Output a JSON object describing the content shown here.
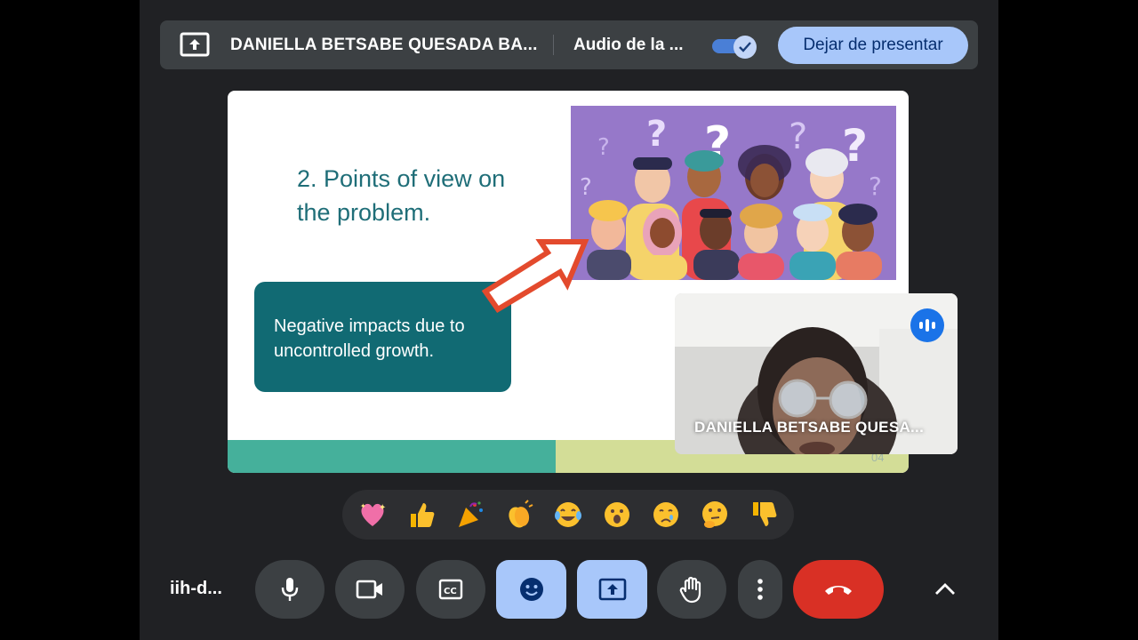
{
  "present_bar": {
    "presenter_name": "DANIELLA BETSABE QUESADA BA...",
    "audio_label": "Audio de la ...",
    "audio_toggle_on": true,
    "stop_presenting_label": "Dejar de presentar"
  },
  "slide": {
    "title": "2. Points of view on the problem.",
    "box_text": "Negative impacts due to uncontrolled growth.",
    "page_number": "04"
  },
  "self_view": {
    "name": "DANIELLA BETSABE QUESA..."
  },
  "reactions": [
    {
      "name": "sparkling-heart",
      "emoji": "💖"
    },
    {
      "name": "thumbs-up",
      "emoji": "👍"
    },
    {
      "name": "party-popper",
      "emoji": "🎉"
    },
    {
      "name": "clapping-hands",
      "emoji": "👏"
    },
    {
      "name": "tears-of-joy",
      "emoji": "😂"
    },
    {
      "name": "surprised",
      "emoji": "😮"
    },
    {
      "name": "crying",
      "emoji": "😢"
    },
    {
      "name": "thinking",
      "emoji": "🤔"
    },
    {
      "name": "thumbs-down",
      "emoji": "👎"
    }
  ],
  "controls": {
    "meeting_code": "iih-d...",
    "icons": [
      "mic-icon",
      "camera-icon",
      "captions-icon",
      "emoji-icon",
      "present-icon",
      "hand-icon",
      "more-icon",
      "end-call-icon",
      "chevron-up-icon"
    ]
  },
  "colors": {
    "accent": "#a8c7fa",
    "end_call": "#d93025",
    "slide_title": "#1f6e78",
    "slide_box": "#116a73"
  }
}
